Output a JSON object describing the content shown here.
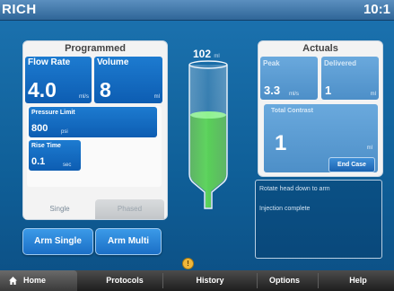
{
  "titlebar": {
    "title": "RICH",
    "clock": "10:1"
  },
  "programmed": {
    "title": "Programmed",
    "flow_rate": {
      "label": "Flow Rate",
      "value": "4.0",
      "unit": "ml/s"
    },
    "volume": {
      "label": "Volume",
      "value": "8",
      "unit": "ml"
    },
    "pressure_limit": {
      "label": "Pressure Limit",
      "value": "800",
      "unit": "psi"
    },
    "rise_time": {
      "label": "Rise Time",
      "value": "0.1",
      "unit": "sec"
    },
    "tabs": {
      "single": "Single",
      "phased": "Phased"
    }
  },
  "syringe": {
    "volume": "102",
    "unit": "ml",
    "fill_fraction": 0.55,
    "fill_color": "#3fcc3f"
  },
  "actuals": {
    "title": "Actuals",
    "peak": {
      "label": "Peak",
      "value": "3.3",
      "unit": "ml/s"
    },
    "delivered": {
      "label": "Delivered",
      "value": "1",
      "unit": "ml"
    },
    "total_contrast": {
      "label": "Total Contrast",
      "value": "1",
      "unit": "ml"
    },
    "end_case": "End Case"
  },
  "messages": [
    "Rotate head down to arm",
    "Injection complete"
  ],
  "buttons": {
    "arm_single": "Arm Single",
    "arm_multi": "Arm Multi"
  },
  "warning_icon": {
    "glyph": "!",
    "color": "#f0b73a"
  },
  "navbar": {
    "home": "Home",
    "protocols": "Protocols",
    "history": "History",
    "options": "Options",
    "help": "Help"
  }
}
